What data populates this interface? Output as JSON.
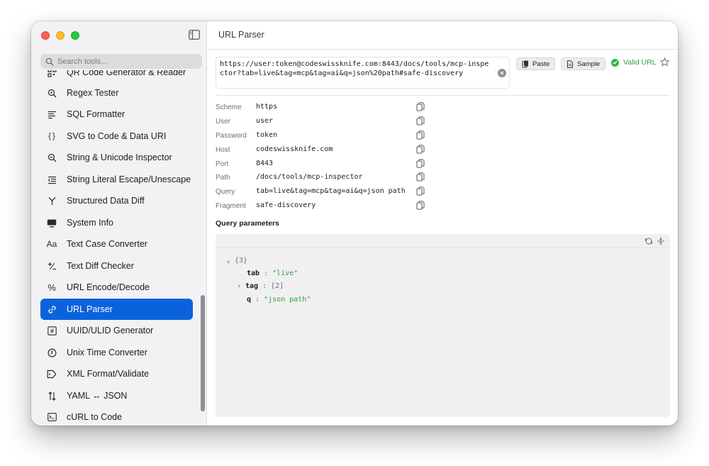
{
  "window": {
    "title": "URL Parser"
  },
  "search": {
    "placeholder": "Search tools..."
  },
  "sidebar": {
    "items": [
      {
        "label": "QR Code Generator & Reader",
        "icon": "qr-icon"
      },
      {
        "label": "Regex Tester",
        "icon": "regex-icon"
      },
      {
        "label": "SQL Formatter",
        "icon": "lines-icon"
      },
      {
        "label": "SVG to Code & Data URI",
        "icon": "braces-icon"
      },
      {
        "label": "String & Unicode Inspector",
        "icon": "magnifier-icon"
      },
      {
        "label": "String Literal Escape/Unescape",
        "icon": "escape-icon"
      },
      {
        "label": "Structured Data Diff",
        "icon": "branch-icon"
      },
      {
        "label": "System Info",
        "icon": "display-icon"
      },
      {
        "label": "Text Case Converter",
        "icon": "text-case-icon"
      },
      {
        "label": "Text Diff Checker",
        "icon": "plus-minus-icon"
      },
      {
        "label": "URL Encode/Decode",
        "icon": "percent-icon"
      },
      {
        "label": "URL Parser",
        "icon": "link-icon",
        "active": true
      },
      {
        "label": "UUID/ULID Generator",
        "icon": "hash-icon"
      },
      {
        "label": "Unix Time Converter",
        "icon": "clock-icon"
      },
      {
        "label": "XML Format/Validate",
        "icon": "tag-icon"
      },
      {
        "label": "YAML ↔ JSON",
        "icon": "swap-icon"
      },
      {
        "label": "cURL to Code",
        "icon": "terminal-icon"
      }
    ]
  },
  "input": {
    "url": "https://user:token@codeswissknife.com:8443/docs/tools/mcp-inspector?tab=live&tag=mcp&tag=ai&q=json%20path#safe-discovery"
  },
  "toolbar": {
    "paste_label": "Paste",
    "sample_label": "Sample",
    "status_label": "Valid URL"
  },
  "fields": [
    {
      "label": "Scheme",
      "value": "https"
    },
    {
      "label": "User",
      "value": "user"
    },
    {
      "label": "Password",
      "value": "token"
    },
    {
      "label": "Host",
      "value": "codeswissknife.com"
    },
    {
      "label": "Port",
      "value": "8443"
    },
    {
      "label": "Path",
      "value": "/docs/tools/mcp-inspector"
    },
    {
      "label": "Query",
      "value": "tab=live&tag=mcp&tag=ai&q=json path"
    },
    {
      "label": "Fragment",
      "value": "safe-discovery"
    }
  ],
  "query_params": {
    "title": "Query parameters",
    "root_count": "{3}",
    "entries": [
      {
        "key": "tab",
        "sep": ":",
        "value": "\"live\""
      },
      {
        "key": "tag",
        "sep": ":",
        "value": "[2]"
      },
      {
        "key": "q",
        "sep": ":",
        "value": "\"json path\""
      }
    ]
  },
  "colors": {
    "accent": "#0a63dd",
    "valid": "#2fb549",
    "string": "#2e9e3e"
  }
}
